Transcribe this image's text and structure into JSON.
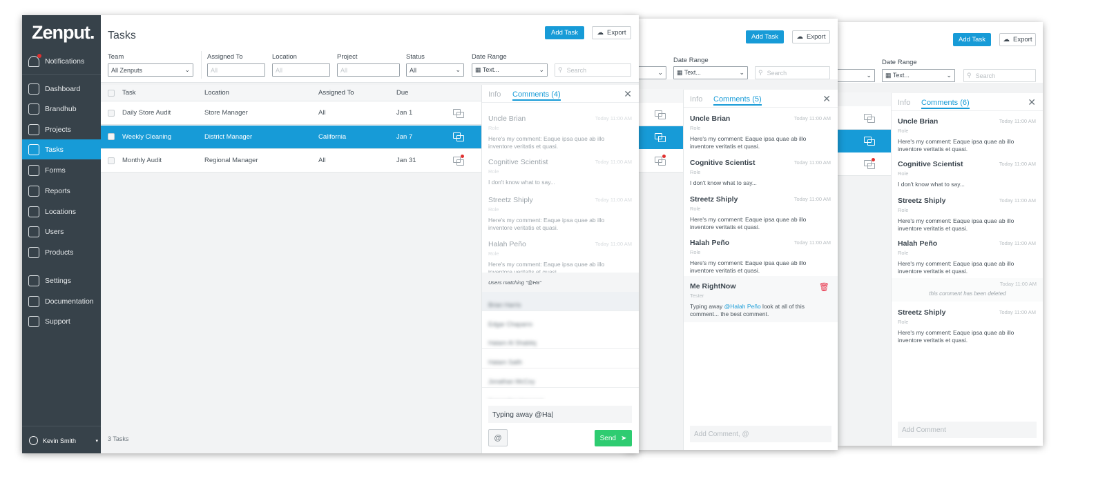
{
  "app": {
    "logo": "Zenput.",
    "accent": "#179bd7",
    "sidebar_bg": "#37424a",
    "send_color": "#2ecc71",
    "danger": "#e8334a"
  },
  "sidebar": {
    "items": [
      {
        "label": "Notifications",
        "icon": "bell-icon"
      },
      {
        "label": "Dashboard",
        "icon": "gauge-icon"
      },
      {
        "label": "Brandhub",
        "icon": "brandhub-icon"
      },
      {
        "label": "Projects",
        "icon": "projects-icon"
      },
      {
        "label": "Tasks",
        "icon": "checkbox-icon",
        "active": true
      },
      {
        "label": "Forms",
        "icon": "form-icon"
      },
      {
        "label": "Reports",
        "icon": "chart-icon"
      },
      {
        "label": "Locations",
        "icon": "map-pin-icon"
      },
      {
        "label": "Users",
        "icon": "users-icon"
      },
      {
        "label": "Products",
        "icon": "barcode-icon"
      },
      {
        "label": "Settings",
        "icon": "gear-icon"
      },
      {
        "label": "Documentation",
        "icon": "book-icon"
      },
      {
        "label": "Support",
        "icon": "support-icon"
      }
    ],
    "user": "Kevin Smith"
  },
  "header": {
    "title": "Tasks",
    "add_task": "Add Task",
    "export": "Export"
  },
  "filters": {
    "team": {
      "label": "Team",
      "value": "All Zenputs"
    },
    "assigned_to": {
      "label": "Assigned To",
      "placeholder": "All"
    },
    "location": {
      "label": "Location",
      "placeholder": "All"
    },
    "project": {
      "label": "Project",
      "placeholder": "All"
    },
    "status": {
      "label": "Status",
      "value": "All"
    },
    "date_range": {
      "label": "Date Range",
      "value": "Text..."
    },
    "search": {
      "placeholder": "Search"
    }
  },
  "table": {
    "columns": [
      "Task",
      "Location",
      "Assigned To",
      "Due"
    ],
    "rows": [
      {
        "task": "Daily Store Audit",
        "location": "Store Manager",
        "assigned": "All",
        "due": "Jan 1"
      },
      {
        "task": "Weekly Cleaning",
        "location": "District Manager",
        "assigned": "California",
        "due": "Jan 7",
        "selected": true
      },
      {
        "task": "Monthly Audit",
        "location": "Regional Manager",
        "assigned": "All",
        "due": "Jan 31",
        "unread": true
      }
    ],
    "footer": "3 Tasks"
  },
  "panels": [
    {
      "tab_info": "Info",
      "tab_comments": "Comments (4)",
      "comments": [
        {
          "name": "Uncle Brian",
          "time": "Today 11:00 AM",
          "role": "Role",
          "text": "Here's my comment: Eaque ipsa quae ab illo inventore veritatis et quasi."
        },
        {
          "name": "Cognitive Scientist",
          "time": "Today 11:00 AM",
          "role": "Role",
          "text": "I don't know what to say..."
        },
        {
          "name": "Streetz Shiply",
          "time": "Today 11:00 AM",
          "role": "Role",
          "text": "Here's my comment: Eaque ipsa quae ab illo inventore veritatis et quasi."
        },
        {
          "name": "Halah Peño",
          "time": "Today 11:00 AM",
          "role": "Role",
          "text": "Here's my comment: Eaque ipsa quae ab illo inventore veritatis et quasi."
        }
      ],
      "mention_header": "Users matching \"@Ha\"",
      "mention_users": [
        "Brian Harris",
        "Edgar Chaparro",
        "Hatam Al Shabitq",
        "Hatam Salih",
        "Jonathan McCoy",
        "Samantha Harwood"
      ],
      "input_value": "Typing away @Ha|",
      "at_button": "@",
      "send": "Send"
    },
    {
      "tab_info": "Info",
      "tab_comments": "Comments (5)",
      "comments": [
        {
          "name": "Uncle Brian",
          "time": "Today 11:00 AM",
          "role": "Role",
          "text": "Here's my comment: Eaque ipsa quae ab illo inventore veritatis et quasi."
        },
        {
          "name": "Cognitive Scientist",
          "time": "Today 11:00 AM",
          "role": "Role",
          "text": "I don't know what to say..."
        },
        {
          "name": "Streetz Shiply",
          "time": "Today 11:00 AM",
          "role": "Role",
          "text": "Here's my comment: Eaque ipsa quae ab illo inventore veritatis et quasi."
        },
        {
          "name": "Halah Peño",
          "time": "Today 11:00 AM",
          "role": "Role",
          "text": "Here's my comment: Eaque ipsa quae ab illo inventore veritatis et quasi."
        }
      ],
      "mine": {
        "name": "Me RightNow",
        "role": "Tester",
        "text_before": "Typing away ",
        "mention": "@Halah Peño",
        "text_after": " look at all of this comment... the best comment."
      },
      "placeholder": "Add Comment, @"
    },
    {
      "tab_info": "Info",
      "tab_comments": "Comments (6)",
      "comments": [
        {
          "name": "Uncle Brian",
          "time": "Today 11:00 AM",
          "role": "Role",
          "text": "Here's my comment: Eaque ipsa quae ab illo inventore veritatis et quasi."
        },
        {
          "name": "Cognitive Scientist",
          "time": "Today 11:00 AM",
          "role": "Role",
          "text": "I don't know what to say..."
        },
        {
          "name": "Streetz Shiply",
          "time": "Today 11:00 AM",
          "role": "Role",
          "text": "Here's my comment: Eaque ipsa quae ab illo inventore veritatis et quasi."
        },
        {
          "name": "Halah Peño",
          "time": "Today 11:00 AM",
          "role": "Role",
          "text": "Here's my comment: Eaque ipsa quae ab illo inventore veritatis et quasi."
        }
      ],
      "deleted": {
        "time": "Today 11:00 AM",
        "text": "this comment has been deleted"
      },
      "last": {
        "name": "Streetz Shiply",
        "time": "Today 11:00 AM",
        "role": "Role",
        "text": "Here's my comment: Eaque ipsa quae ab illo inventore veritatis et quasi."
      },
      "placeholder": "Add Comment"
    }
  ]
}
